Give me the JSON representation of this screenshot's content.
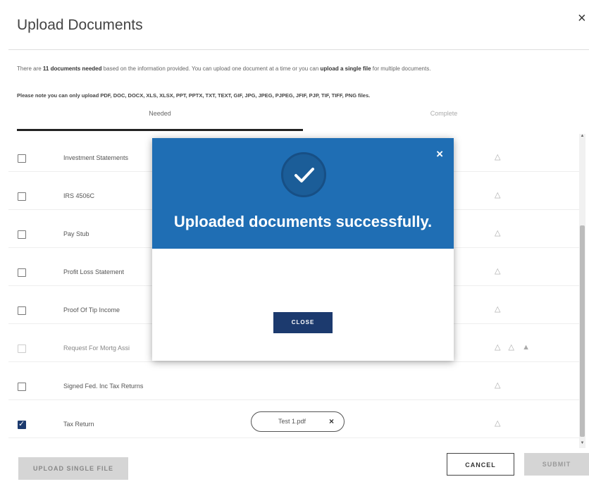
{
  "dialog": {
    "title": "Upload Documents",
    "close_glyph": "×"
  },
  "intro": {
    "part1": "There are ",
    "count_bold": "11 documents needed",
    "part2": " based on the information provided. You can upload one document at a time or you can ",
    "single_bold": "upload a single file",
    "part3": " for multiple documents.",
    "note": "Please note you can only upload PDF, DOC, DOCX, XLS, XLSX, PPT, PPTX, TXT, TEXT, GIF, JPG, JPEG, PJPEG, JFIF, PJP, TIF, TIFF, PNG files."
  },
  "tabs": [
    {
      "label": "Needed",
      "active": true
    },
    {
      "label": "Complete",
      "active": false
    }
  ],
  "documents": [
    {
      "name": "Investment Statements",
      "checked": false,
      "disabled": false
    },
    {
      "name": "IRS 4506C",
      "checked": false,
      "disabled": false
    },
    {
      "name": "Pay Stub",
      "checked": false,
      "disabled": false
    },
    {
      "name": "Profit Loss Statement",
      "checked": false,
      "disabled": false
    },
    {
      "name": "Proof Of Tip Income",
      "checked": false,
      "disabled": false
    },
    {
      "name": "Request For Mortg Assi",
      "checked": false,
      "disabled": true
    },
    {
      "name": "Signed Fed. Inc Tax Returns",
      "checked": false,
      "disabled": false
    },
    {
      "name": "Tax Return",
      "checked": true,
      "disabled": false
    }
  ],
  "attached_file": {
    "name": "Test 1.pdf",
    "remove_glyph": "×"
  },
  "footer": {
    "upload_single_label": "UPLOAD SINGLE FILE",
    "cancel_label": "CANCEL",
    "submit_label": "SUBMIT"
  },
  "modal": {
    "message": "Uploaded documents successfully.",
    "close_button_label": "CLOSE",
    "close_glyph": "×",
    "header_color": "#1f6eb4",
    "button_color": "#1c3a6e"
  }
}
